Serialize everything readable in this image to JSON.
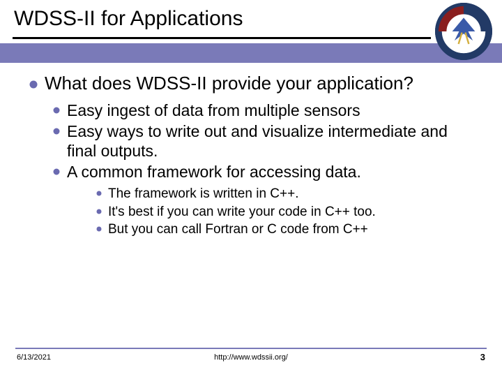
{
  "colors": {
    "accent": "#7a7ab8",
    "bullet": "#6a6ab0"
  },
  "title": "WDSS-II for Applications",
  "logo": {
    "name": "nssl-logo",
    "alt": "National Severe Storms Laboratory"
  },
  "body": {
    "point": "What does WDSS-II provide your application?",
    "subs": [
      "Easy ingest of data from multiple sensors",
      "Easy ways to write out and visualize intermediate and final outputs.",
      "A common framework for accessing data."
    ],
    "subsubs": [
      "The framework is written in C++.",
      "It's best if you can write your code in C++ too.",
      "But you can call Fortran or C code from C++"
    ]
  },
  "footer": {
    "date": "6/13/2021",
    "url": "http://www.wdssii.org/",
    "page": "3"
  }
}
